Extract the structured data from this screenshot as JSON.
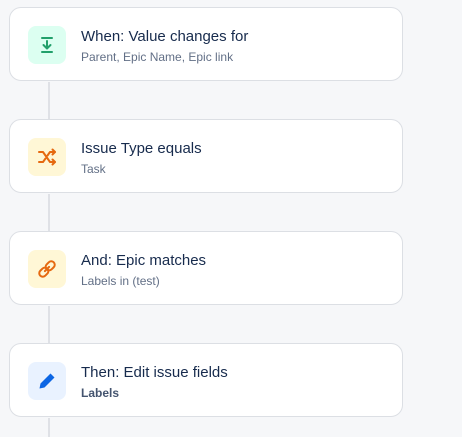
{
  "colors": {
    "trigger_bg": "#dcfff1",
    "trigger_icon": "#22a06b",
    "condition_bg": "#fff7d6",
    "condition_icon": "#e56910",
    "action_bg": "#e9f2ff",
    "action_icon": "#0c66e4"
  },
  "rules": [
    {
      "icon": "download-arrow-icon",
      "title": "When: Value changes for",
      "subtitle": "Parent, Epic Name, Epic link"
    },
    {
      "icon": "shuffle-icon",
      "title": "Issue Type equals",
      "subtitle": "Task"
    },
    {
      "icon": "link-icon",
      "title": "And: Epic matches",
      "subtitle": "Labels in (test)"
    },
    {
      "icon": "pencil-icon",
      "title": "Then: Edit issue fields",
      "subtitle": "Labels"
    }
  ]
}
